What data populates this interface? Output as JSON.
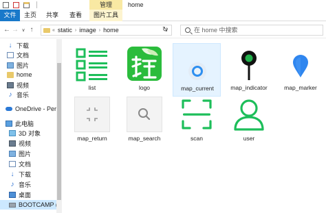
{
  "window": {
    "title": "home",
    "manage_tab": "管理"
  },
  "ribbon": {
    "tabs": [
      "文件",
      "主页",
      "共享",
      "查看",
      "图片工具"
    ]
  },
  "address": {
    "crumbs": [
      "static",
      "image",
      "home"
    ]
  },
  "search": {
    "placeholder": "在 home 中搜索"
  },
  "navpane": {
    "items": [
      {
        "label": "下载",
        "icon": "download-icon"
      },
      {
        "label": "文档",
        "icon": "documents-icon"
      },
      {
        "label": "图片",
        "icon": "pictures-icon"
      },
      {
        "label": "home",
        "icon": "folder-icon"
      },
      {
        "label": "视频",
        "icon": "videos-icon"
      },
      {
        "label": "音乐",
        "icon": "music-icon"
      },
      {
        "label": "OneDrive - Perso",
        "icon": "onedrive-icon"
      },
      {
        "label": "此电脑",
        "icon": "this-pc-icon"
      },
      {
        "label": "3D 对象",
        "icon": "3d-objects-icon"
      },
      {
        "label": "视频",
        "icon": "videos-icon"
      },
      {
        "label": "图片",
        "icon": "pictures-icon"
      },
      {
        "label": "文档",
        "icon": "documents-icon"
      },
      {
        "label": "下载",
        "icon": "download-icon"
      },
      {
        "label": "音乐",
        "icon": "music-icon"
      },
      {
        "label": "桌面",
        "icon": "desktop-icon"
      },
      {
        "label": "BOOTCAMP (C",
        "icon": "drive-icon"
      }
    ]
  },
  "files": [
    {
      "name": "list",
      "icon": "list-icon"
    },
    {
      "name": "logo",
      "icon": "logo-icon"
    },
    {
      "name": "map_current",
      "icon": "map-current-icon"
    },
    {
      "name": "map_indicator",
      "icon": "map-indicator-icon"
    },
    {
      "name": "map_marker",
      "icon": "map-marker-icon"
    },
    {
      "name": "map_return",
      "icon": "map-return-icon"
    },
    {
      "name": "map_search",
      "icon": "map-search-icon"
    },
    {
      "name": "scan",
      "icon": "scan-icon"
    },
    {
      "name": "user",
      "icon": "user-icon"
    }
  ],
  "colors": {
    "accent": "#1979ca",
    "green": "#1dbe5a",
    "manage": "#f9e9a3"
  }
}
